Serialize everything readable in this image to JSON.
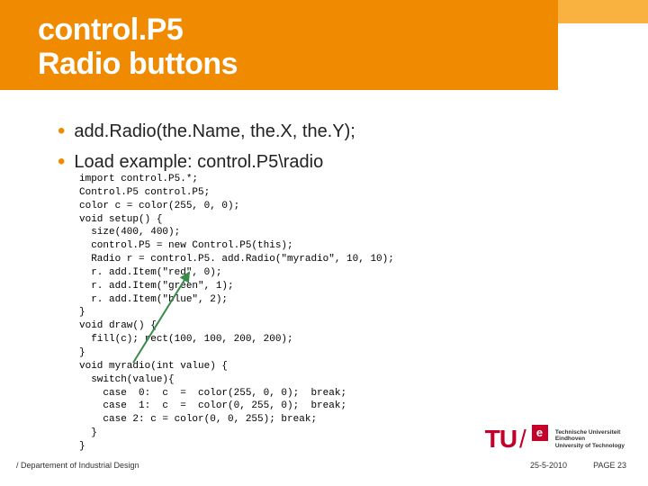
{
  "title": {
    "line1": "control.P5",
    "line2": "Radio buttons"
  },
  "bullets": [
    "add.Radio(the.Name, the.X, the.Y);",
    "Load example: control.P5\\radio"
  ],
  "code": "import control.P5.*;\nControl.P5 control.P5;\ncolor c = color(255, 0, 0);\nvoid setup() {\n  size(400, 400);\n  control.P5 = new Control.P5(this);\n  Radio r = control.P5. add.Radio(\"myradio\", 10, 10);\n  r. add.Item(\"red\", 0);\n  r. add.Item(\"green\", 1);\n  r. add.Item(\"blue\", 2);\n}\nvoid draw() {\n  fill(c); rect(100, 100, 200, 200);\n}\nvoid myradio(int value) {\n  switch(value){\n    case  0:  c  =  color(255, 0, 0);  break;\n    case  1:  c  =  color(0, 255, 0);  break;\n    case 2: c = color(0, 0, 255); break;\n  }\n}",
  "logo": {
    "tu": "TU",
    "university_line1": "Technische Universiteit",
    "university_line2": "Eindhoven",
    "university_line3": "University of Technology"
  },
  "footer": {
    "dept": "/ Departement of Industrial Design",
    "date": "25-5-2010",
    "page": "PAGE 23"
  }
}
